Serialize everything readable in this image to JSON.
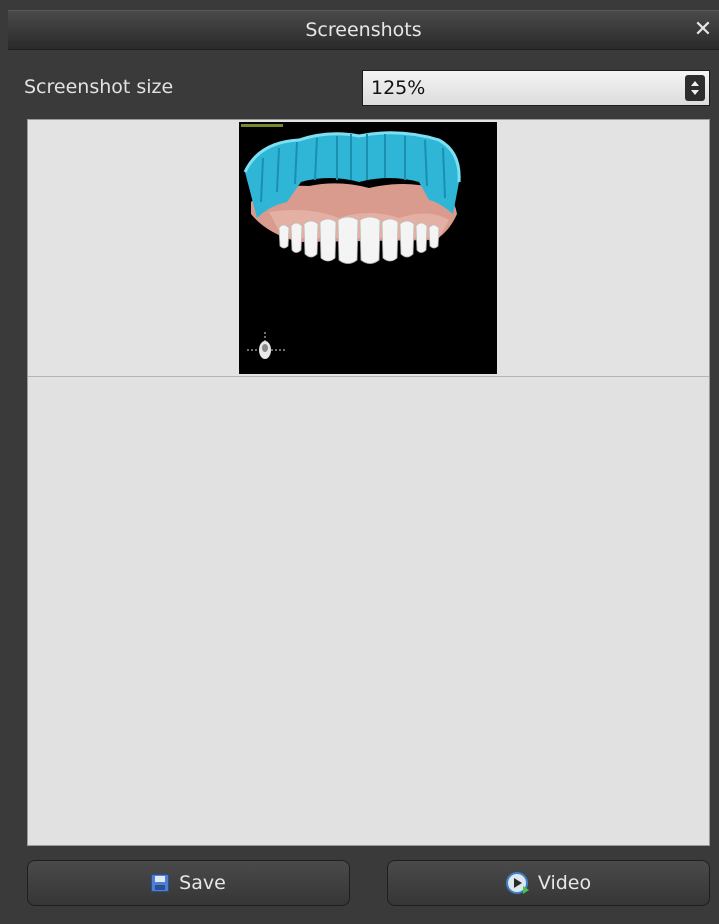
{
  "window": {
    "title": "Screenshots",
    "close_glyph": "✕",
    "close_icon": "close-icon"
  },
  "size_setting": {
    "label": "Screenshot size",
    "value": "125%"
  },
  "preview": {
    "thumbnail_icons": [
      "dental-model-thumbnail",
      "orientation-icon"
    ]
  },
  "buttons": {
    "save_label": "Save",
    "save_icon": "floppy-disk-icon",
    "video_label": "Video",
    "video_icon": "video-play-icon"
  }
}
